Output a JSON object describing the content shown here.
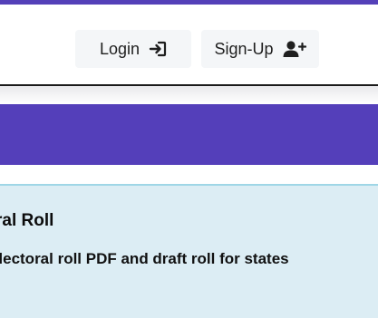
{
  "header": {
    "login_label": "Login",
    "signup_label": "Sign-Up",
    "icons": {
      "login": "login-arrow-icon",
      "signup": "user-plus-icon"
    }
  },
  "info": {
    "title": "Electoral Roll",
    "description": "Download electoral roll PDF and draft roll for states"
  },
  "colors": {
    "brand": "#543fba",
    "info_bg": "#dcedf4",
    "info_border": "#9fd6e6",
    "button_bg": "#f4f6f8"
  }
}
